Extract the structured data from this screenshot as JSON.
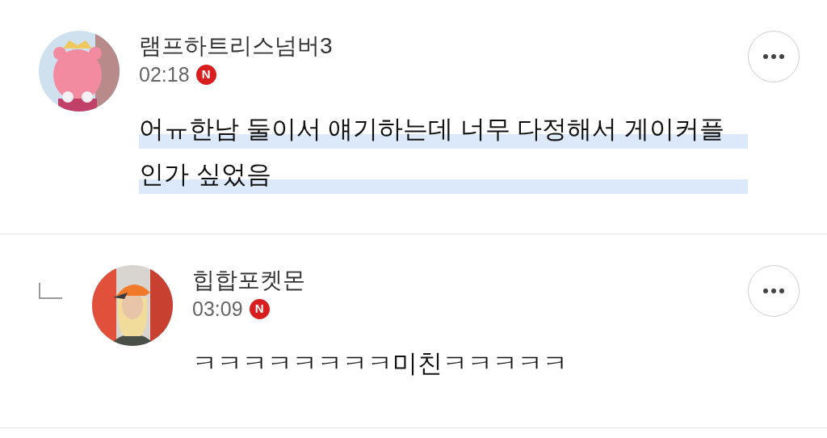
{
  "comments": [
    {
      "kind": "comment",
      "author": "램프하트리스넘버3",
      "time": "02:18",
      "badge": "N",
      "text": "어ㅠ한남 둘이서 얘기하는데 너무 다정해서 게이커플인가 싶었음",
      "highlighted": true
    },
    {
      "kind": "reply",
      "author": "힙합포켓몬",
      "time": "03:09",
      "badge": "N",
      "text": "ㅋㅋㅋㅋㅋㅋㅋㅋ미친ㅋㅋㅋㅋㅋ",
      "highlighted": false
    }
  ]
}
